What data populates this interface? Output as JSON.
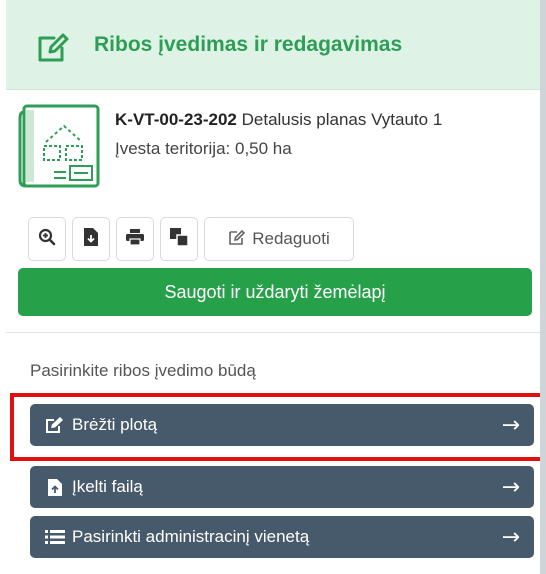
{
  "header": {
    "title": "Ribos įvedimas ir redagavimas",
    "icon": "edit-square-icon"
  },
  "plan": {
    "code": "K-VT-00-23-202",
    "description": "Detalusis planas Vytauto 1",
    "area_text": "Įvesta teritorija: 0,50 ha",
    "icon": "plan-document-icon"
  },
  "toolbar": {
    "buttons": [
      {
        "icon": "zoom-icon"
      },
      {
        "icon": "file-download-icon"
      },
      {
        "icon": "print-icon"
      },
      {
        "icon": "copy-icon"
      }
    ],
    "edit_label": "Redaguoti"
  },
  "save_label": "Saugoti ir uždaryti žemėlapį",
  "methods": {
    "label": "Pasirinkite ribos įvedimo būdą",
    "items": [
      {
        "label": "Brėžti plotą",
        "icon": "draw-icon",
        "arrow": "→"
      },
      {
        "label": "Įkelti failą",
        "icon": "file-upload-icon",
        "arrow": "→"
      },
      {
        "label": "Pasirinkti administracinį vienetą",
        "icon": "list-icon",
        "arrow": "→"
      }
    ]
  },
  "colors": {
    "accent": "#27a04a",
    "header_bg": "#dff2e6",
    "method_bg": "#475a6b",
    "highlight": "#e01010"
  }
}
